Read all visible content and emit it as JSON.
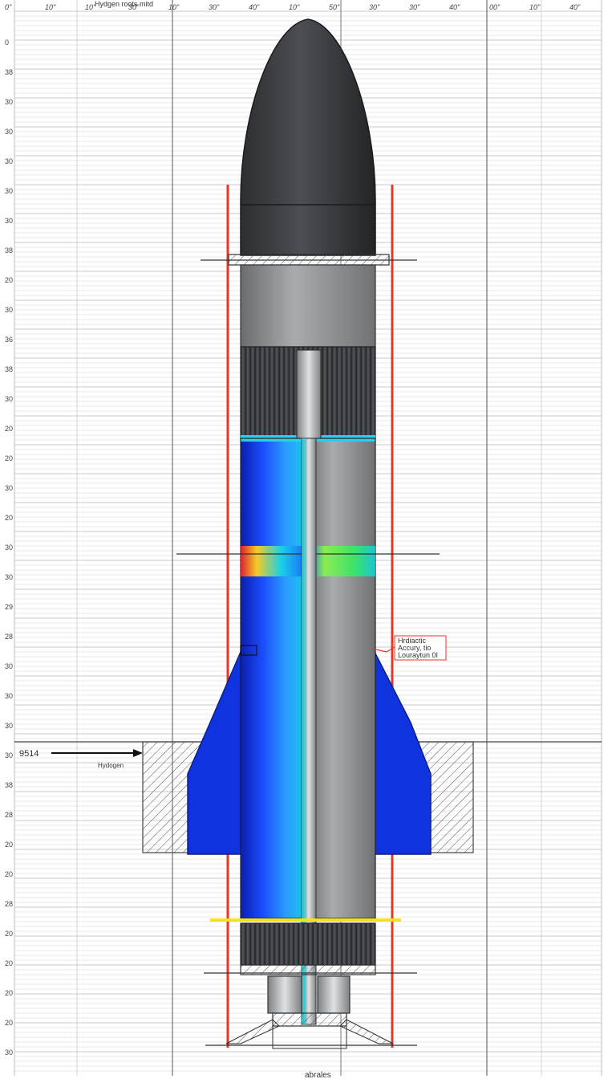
{
  "title": "Hydgen roots mitd",
  "top_ticks": [
    "0\"",
    "10\"",
    "10\"",
    "30\"",
    "10\"",
    "30\"",
    "40\"",
    "10\"",
    "50\"",
    "30\"",
    "30\"",
    "40\"",
    "00\"",
    "10\"",
    "40\""
  ],
  "row_labels": [
    "0",
    "38",
    "30",
    "30",
    "30",
    "30",
    "30",
    "38",
    "20",
    "30",
    "36",
    "38",
    "30",
    "20",
    "20",
    "30",
    "20",
    "30",
    "30",
    "29",
    "28",
    "30",
    "30",
    "30",
    "30",
    "38",
    "28",
    "20",
    "20",
    "28",
    "20",
    "20",
    "20",
    "20",
    "30",
    "20"
  ],
  "callout": {
    "line1": "Hrdiactic",
    "line2": "Accury, tio",
    "line3": "Louraytun 0I"
  },
  "left_label": {
    "value": "9514",
    "text": "Hydogen"
  },
  "bottom_label": "abrales",
  "colors": {
    "guide": "#e23a2a",
    "nose": "#3a3c3f",
    "hot": "#e8212a",
    "cold": "#1030c8"
  }
}
